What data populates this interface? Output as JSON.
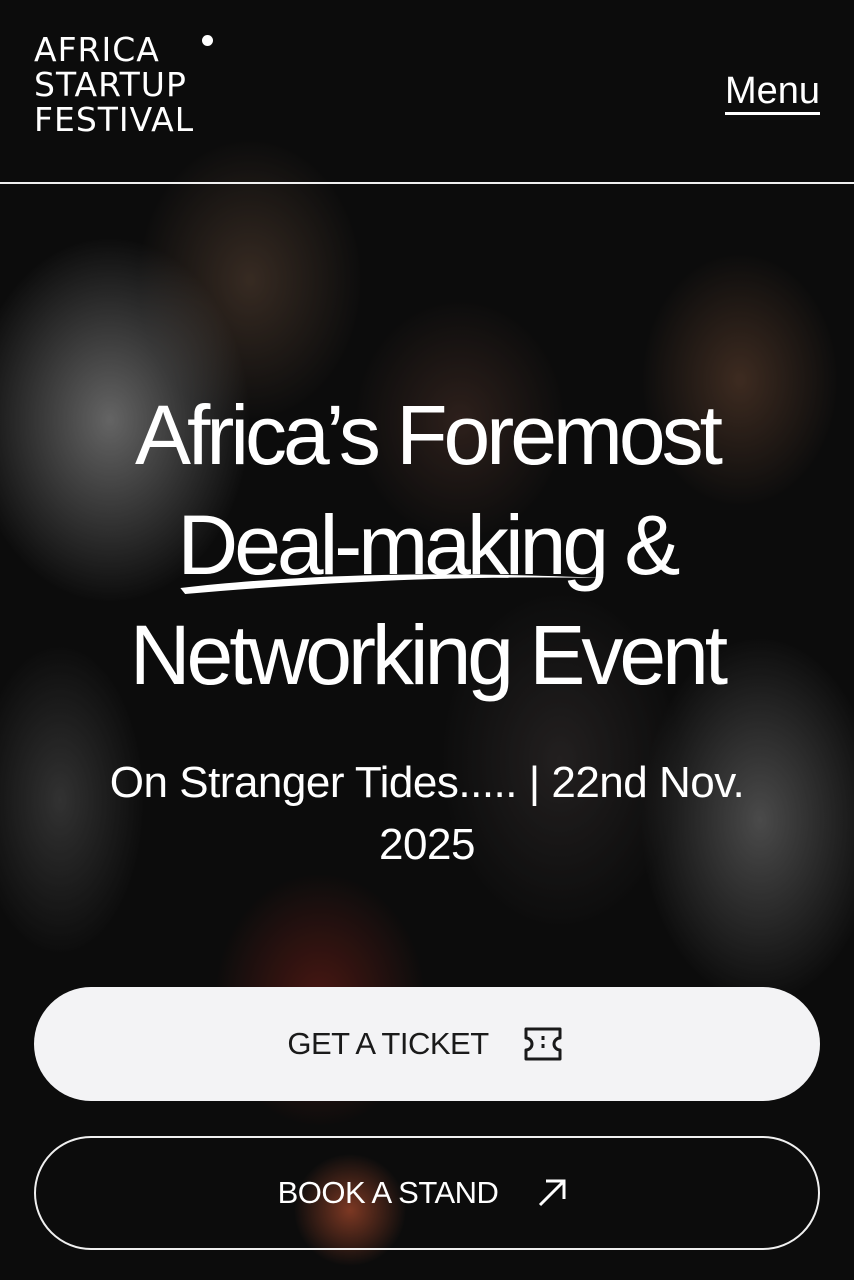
{
  "header": {
    "logo": {
      "line1": "AFRICA",
      "line2": "STARTUP",
      "line3": "FESTIVAL"
    },
    "menu_label": "Menu"
  },
  "hero": {
    "headline_part1": "Africa’s Foremost",
    "headline_underlined": "Deal-making",
    "headline_part2": " &",
    "headline_part3": "Networking Event",
    "subline": "On Stranger Tides..... | 22nd Nov. 2025"
  },
  "buttons": {
    "ticket_label": "GET A TICKET",
    "ticket_icon": "ticket-icon",
    "stand_label": "BOOK A STAND",
    "stand_icon": "arrow-up-right-icon"
  },
  "colors": {
    "background": "#000000",
    "text": "#ffffff",
    "primary_button_bg": "#f3f3f5",
    "primary_button_text": "#1a1a1a"
  }
}
